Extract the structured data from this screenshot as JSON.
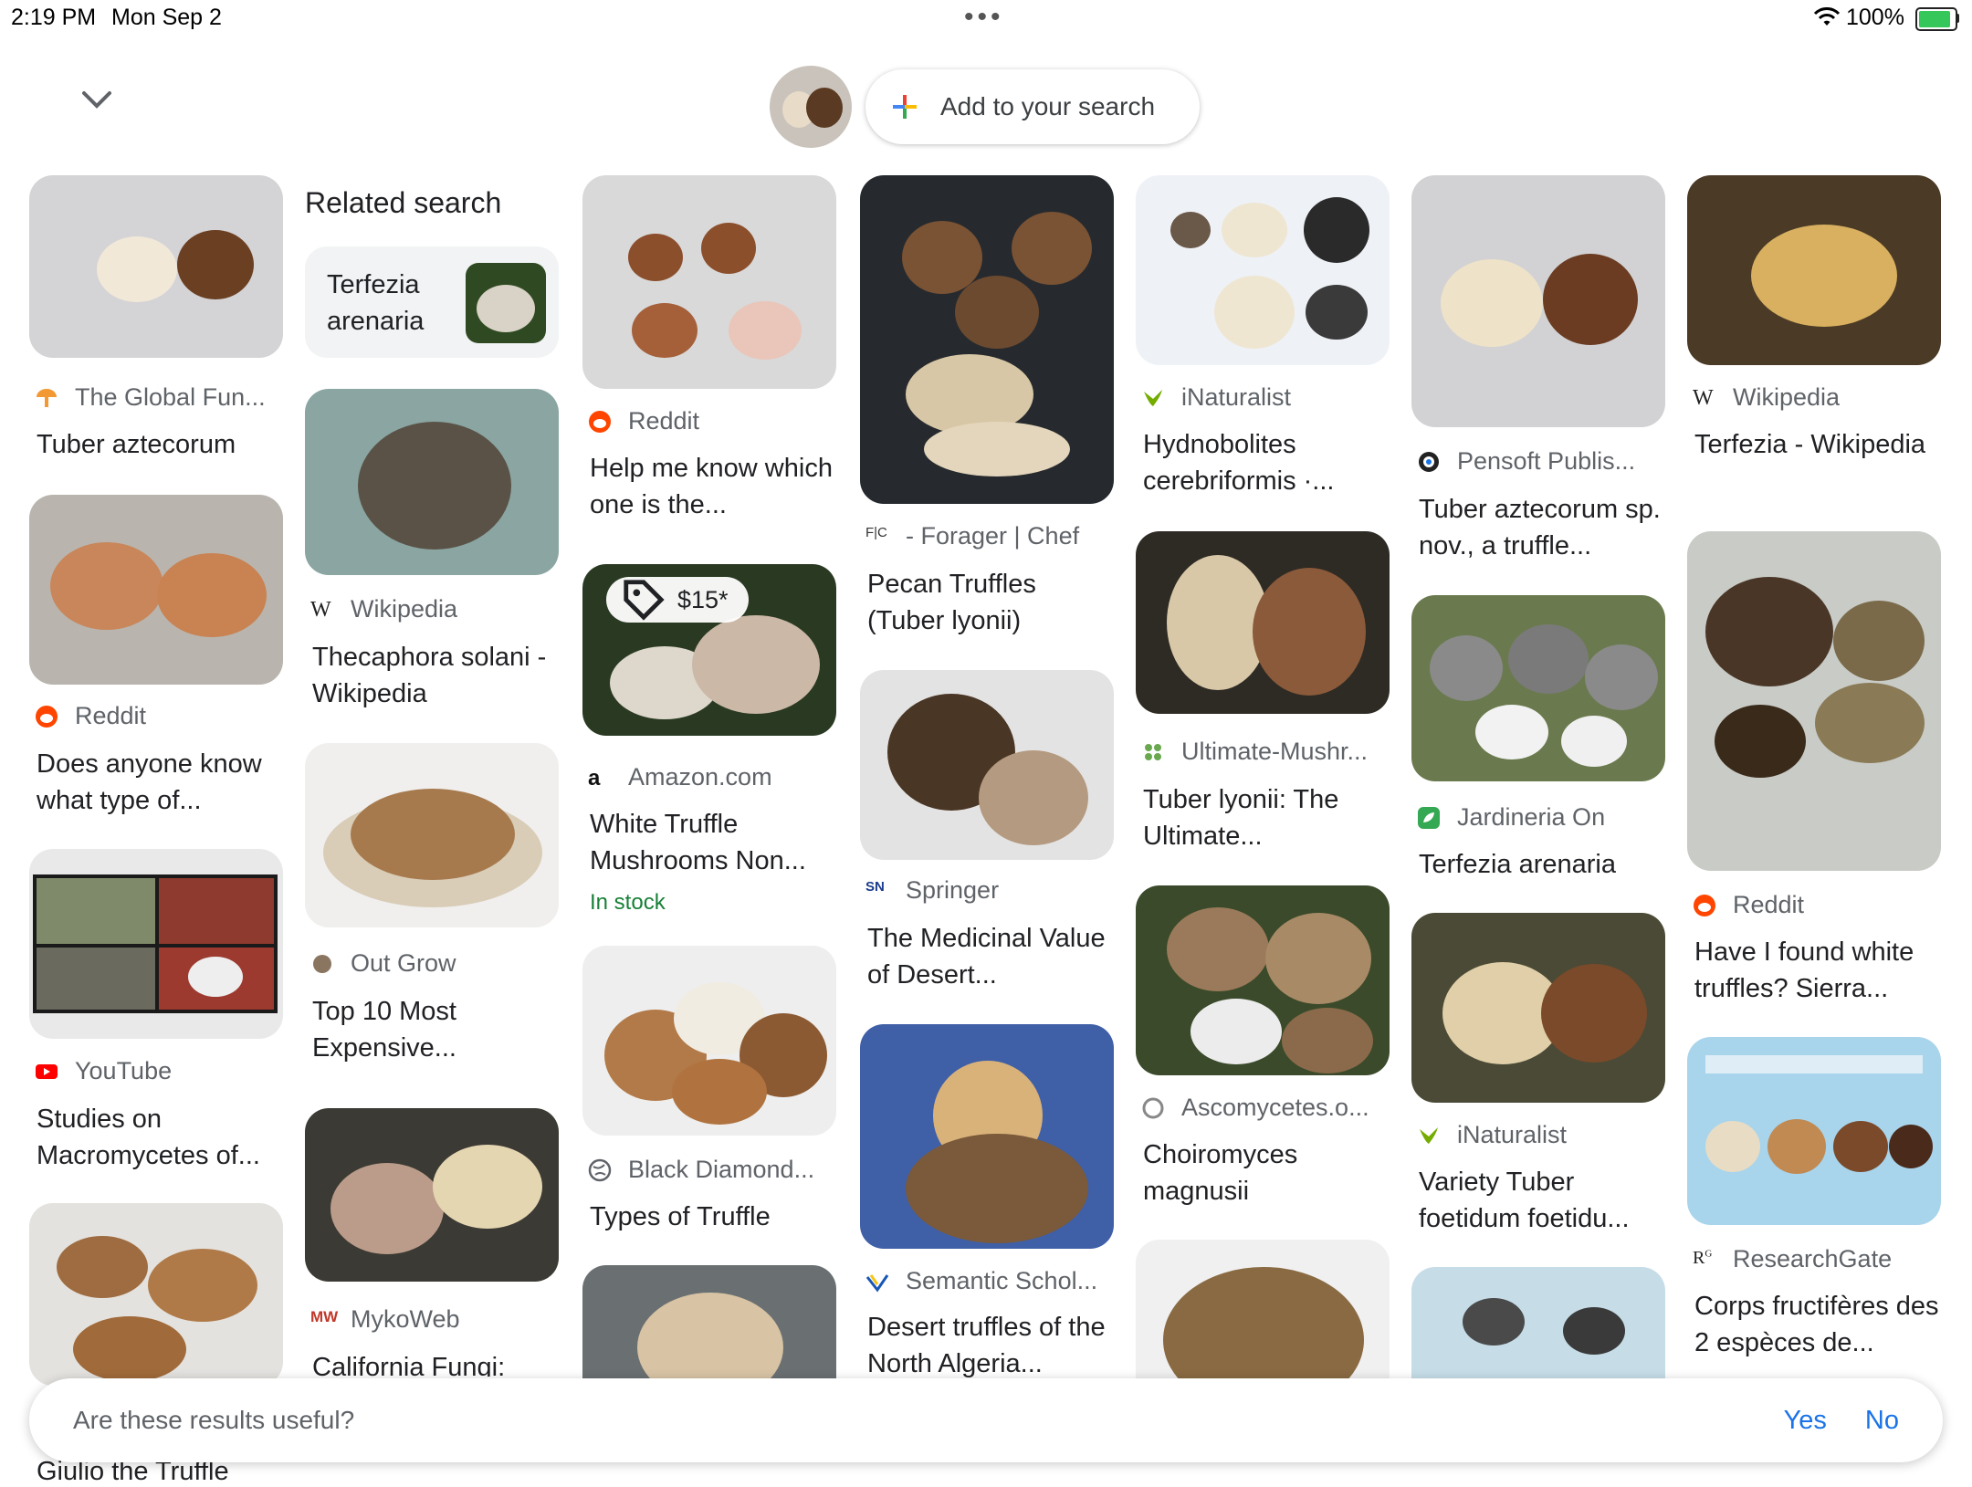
{
  "status_bar": {
    "time": "2:19 PM",
    "date": "Mon Sep 2",
    "battery": "100%",
    "battery_level": 1.0
  },
  "header": {
    "add_search_label": "Add to your search"
  },
  "related": {
    "heading": "Related search",
    "item": "Terfezia arenaria"
  },
  "cards": [
    {
      "source": "The Global Fun...",
      "title": "Tuber aztecorum"
    },
    {
      "source": "Reddit",
      "title": "Does anyone know what type of..."
    },
    {
      "source": "YouTube",
      "title": "Studies on Macromycetes of..."
    },
    {
      "source": "Wikipedia",
      "title": "Thecaphora solani - Wikipedia"
    },
    {
      "source": "Out Grow",
      "title": "Top 10 Most Expensive..."
    },
    {
      "source": "MykoWeb",
      "title": "California Fungi:"
    },
    {
      "source": "Reddit",
      "title": "Help me know which one is the..."
    },
    {
      "source": "Amazon.com",
      "title": "White Truffle Mushrooms Non...",
      "price": "$15*",
      "stock": "In stock"
    },
    {
      "source": "Black Diamond...",
      "title": "Types of Truffle"
    },
    {
      "source": "- Forager | Chef",
      "title": "Pecan Truffles (Tuber lyonii)"
    },
    {
      "source": "Springer",
      "title": "The Medicinal Value of Desert..."
    },
    {
      "source": "Semantic Schol...",
      "title": "Desert truffles of the North Algeria..."
    },
    {
      "source": "iNaturalist",
      "title": "Hydnobolites cerebriformis ·..."
    },
    {
      "source": "Ultimate-Mushr...",
      "title": "Tuber lyonii: The Ultimate..."
    },
    {
      "source": "Ascomycetes.o...",
      "title": "Choiromyces magnusii"
    },
    {
      "source": "Pensoft Publis...",
      "title": "Tuber aztecorum sp. nov., a truffle..."
    },
    {
      "source": "Jardineria On",
      "title": "Terfezia arenaria"
    },
    {
      "source": "iNaturalist",
      "title": "Variety Tuber foetidum foetidu..."
    },
    {
      "source": "Wikipedia",
      "title": "Terfezia - Wikipedia"
    },
    {
      "source": "Reddit",
      "title": "Have I found white truffles? Sierra..."
    },
    {
      "source": "ResearchGate",
      "title": "Corps fructifères des 2 espèces de..."
    }
  ],
  "feedback": {
    "question": "Are these results useful?",
    "yes": "Yes",
    "no": "No"
  },
  "peek": {
    "title": "Giulio the Truffle"
  },
  "icons": [
    "chevron-down-icon",
    "plus-icon",
    "wifi-icon",
    "battery-icon",
    "tag-icon"
  ],
  "colors": {
    "link": "#1a73e8",
    "stock": "#188038",
    "battery": "#35c759"
  }
}
